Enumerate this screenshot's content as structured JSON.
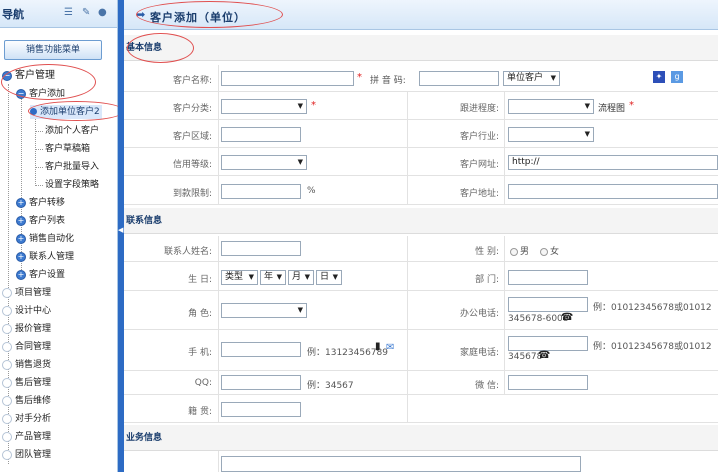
{
  "sidebar": {
    "title": "导航",
    "sales_menu_btn": "销售功能菜单",
    "customer_mgmt": "客户管理",
    "customer_add": "客户添加",
    "sub_items": [
      "添加单位客户2",
      "添加个人客户",
      "客户草稿箱",
      "客户批量导入",
      "设置字段策略"
    ],
    "customer_items": [
      "客户转移",
      "客户列表",
      "销售自动化",
      "联系人管理",
      "客户设置"
    ],
    "modules": [
      "项目管理",
      "设计中心",
      "报价管理",
      "合同管理",
      "销售退货",
      "售后管理",
      "售后维修",
      "对手分析",
      "产品管理",
      "团队管理"
    ]
  },
  "header": {
    "title": "客户添加（单位）"
  },
  "basic": {
    "section": "基本信息",
    "name_label": "客户名称:",
    "pinyin_label": "拼 音 码:",
    "type_value": "单位客户",
    "category_label": "客户分类:",
    "progress_label": "跟进程度:",
    "flowchart": "流程图",
    "region_label": "客户区域:",
    "industry_label": "客户行业:",
    "credit_label": "信用等级:",
    "website_label": "客户网址:",
    "website_value": "http://",
    "limit_label": "到款限制:",
    "limit_unit": "%",
    "address_label": "客户地址:"
  },
  "contact": {
    "section": "联系信息",
    "name_label": "联系人姓名:",
    "gender_label": "性 别:",
    "male": "男",
    "female": "女",
    "birthday_label": "生 日:",
    "birth_type": "类型",
    "birth_year": "年",
    "birth_month": "月",
    "birth_day": "日",
    "dept_label": "部 门:",
    "role_label": "角 色:",
    "office_label": "办公电话:",
    "office_hint_a": "例：01012345678或01012",
    "office_hint_b": "345678-6008",
    "mobile_label": "手 机:",
    "mobile_hint": "例：13123456789",
    "home_label": "家庭电话:",
    "home_hint_a": "例：01012345678或01012",
    "home_hint_b": "345678",
    "qq_label": "QQ:",
    "qq_hint": "例：34567",
    "wechat_label": "微 信:",
    "native_label": "籍 贯:"
  },
  "business": {
    "section": "业务信息"
  },
  "colors": {
    "accent": "#2d6bc4",
    "required": "#e02020",
    "annotation": "#e05050"
  }
}
